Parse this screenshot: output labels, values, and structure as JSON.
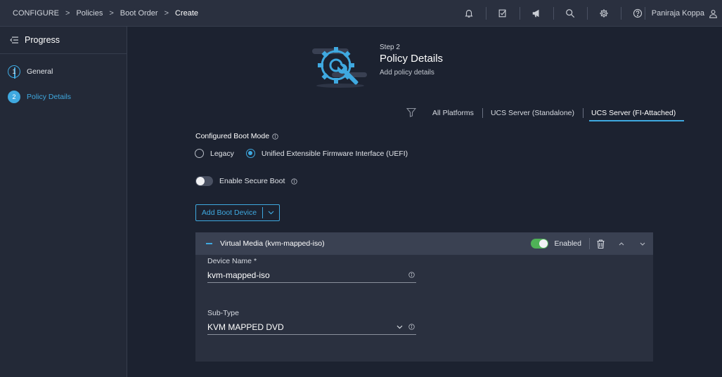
{
  "breadcrumb": [
    "CONFIGURE",
    "Policies",
    "Boot Order",
    "Create"
  ],
  "topbar": {
    "icons": [
      "bell-icon",
      "checklist-icon",
      "megaphone-icon",
      "search-icon",
      "gear-icon",
      "help-icon"
    ],
    "user_name": "Paniraja Koppa"
  },
  "sidebar": {
    "title": "Progress",
    "steps": [
      {
        "num": "1",
        "label": "General"
      },
      {
        "num": "2",
        "label": "Policy Details"
      }
    ]
  },
  "header": {
    "step": "Step 2",
    "title": "Policy Details",
    "subtitle": "Add policy details"
  },
  "platform_tabs": [
    "All Platforms",
    "UCS Server (Standalone)",
    "UCS Server (FI-Attached)"
  ],
  "boot_mode": {
    "label": "Configured Boot Mode",
    "options": [
      "Legacy",
      "Unified Extensible Firmware Interface (UEFI)"
    ],
    "selected": "Unified Extensible Firmware Interface (UEFI)"
  },
  "secure_boot": {
    "label": "Enable Secure Boot",
    "enabled": false
  },
  "add_boot_device": {
    "label": "Add Boot Device"
  },
  "device": {
    "title": "Virtual Media (kvm-mapped-iso)",
    "enabled_label": "Enabled",
    "enabled": true,
    "device_name_label": "Device Name *",
    "device_name_value": "kvm-mapped-iso",
    "subtype_label": "Sub-Type",
    "subtype_value": "KVM MAPPED DVD"
  },
  "colors": {
    "accent": "#3fa9e0",
    "toggle_on": "#4fb257",
    "bg": "#1c2230"
  }
}
